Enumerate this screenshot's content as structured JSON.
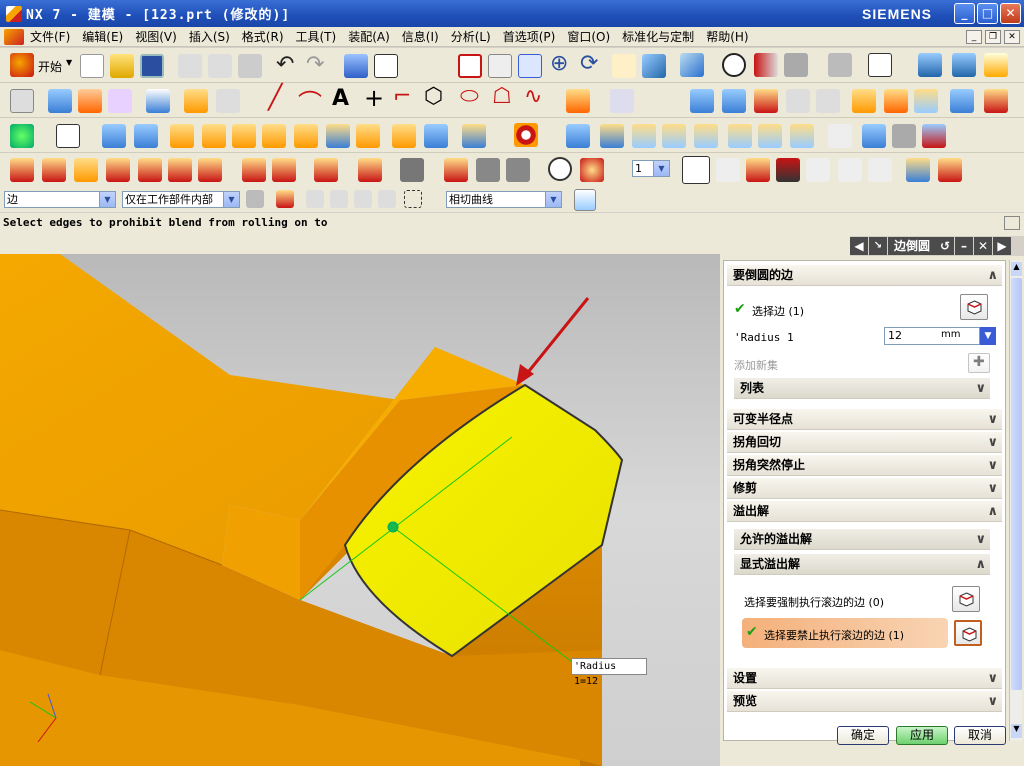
{
  "window": {
    "title": "NX 7 - 建模 - [123.prt (修改的)]",
    "brand": "SIEMENS",
    "buttons": [
      "_",
      "□",
      "✕"
    ]
  },
  "menu": [
    "文件(F)",
    "编辑(E)",
    "视图(V)",
    "插入(S)",
    "格式(R)",
    "工具(T)",
    "装配(A)",
    "信息(I)",
    "分析(L)",
    "首选项(P)",
    "窗口(O)",
    "标准化与定制",
    "帮助(H)"
  ],
  "toolbar": {
    "start_label": "开始"
  },
  "selection_bar": {
    "filter": "边",
    "scope": "仅在工作部件内部",
    "curve_rule": "相切曲线",
    "layer_value": "1"
  },
  "status": {
    "prompt": "Select edges to prohibit blend from rolling on to"
  },
  "viewport": {
    "radius_label": "'Radius 1=12"
  },
  "dialog": {
    "title": "边倒圆",
    "sections": {
      "edges": "要倒圆的边",
      "select_edge": "选择边 (1)",
      "radius_label": "'Radius 1",
      "radius_value": "12",
      "radius_unit": "mm",
      "add_new_set": "添加新集",
      "list": "列表",
      "variable_radius": "可变半径点",
      "corner_setback": "拐角回切",
      "corner_stop": "拐角突然停止",
      "trim": "修剪",
      "overflow": "溢出解",
      "allowed_overflow": "允许的溢出解",
      "explicit_overflow": "显式溢出解",
      "force_roll": "选择要强制执行滚边的边 (0)",
      "prohibit_roll": "选择要禁止执行滚边的边 (1)",
      "settings": "设置",
      "preview": "预览"
    },
    "buttons": {
      "ok": "确定",
      "apply": "应用",
      "cancel": "取消"
    }
  },
  "colors": {
    "accent": "#f7a400",
    "blend_face": "#f7f000",
    "title_bar": "#1e4fb8",
    "arrow": "#c81414"
  }
}
